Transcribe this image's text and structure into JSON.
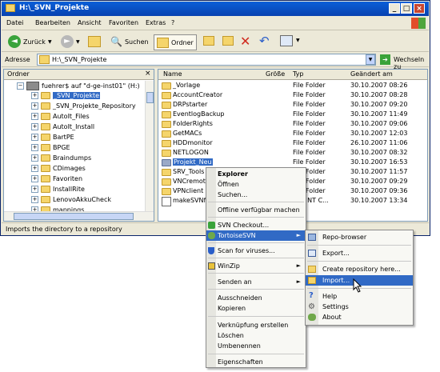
{
  "window": {
    "title": "H:\\_SVN_Projekte",
    "menu": [
      "Datei",
      "Bearbeiten",
      "Ansicht",
      "Favoriten",
      "Extras",
      "?"
    ],
    "toolbar": {
      "back": "Zurück",
      "search": "Suchen",
      "folders": "Ordner"
    },
    "address": {
      "label": "Adresse",
      "value": "H:\\_SVN_Projekte",
      "go": "Wechseln zu"
    },
    "status": "Imports the directory to a repository"
  },
  "tree": {
    "header": "Ordner",
    "root": "fuehrer$ auf \"d-ge-inst01\" (H:)",
    "items": [
      "_SVN_Projekte",
      "_SVN_Projekte_Repository",
      "AutoIt_Files",
      "AutoIt_Install",
      "BartPE",
      "BPGE",
      "Braindumps",
      "CDimages",
      "Favoriten",
      "InstallRite",
      "LenovoAkkuCheck",
      "mappings"
    ]
  },
  "files": {
    "columns": [
      "Name",
      "Größe",
      "Typ",
      "Geändert am"
    ],
    "rows": [
      {
        "name": "_Vorlage",
        "size": "",
        "type": "File Folder",
        "date": "30.10.2007 08:26"
      },
      {
        "name": "AccountCreator",
        "size": "",
        "type": "File Folder",
        "date": "30.10.2007 08:28"
      },
      {
        "name": "DRPstarter",
        "size": "",
        "type": "File Folder",
        "date": "30.10.2007 09:20"
      },
      {
        "name": "EventlogBackup",
        "size": "",
        "type": "File Folder",
        "date": "30.10.2007 11:49"
      },
      {
        "name": "FolderRights",
        "size": "",
        "type": "File Folder",
        "date": "30.10.2007 09:06"
      },
      {
        "name": "GetMACs",
        "size": "",
        "type": "File Folder",
        "date": "30.10.2007 12:03"
      },
      {
        "name": "HDDmonitor",
        "size": "",
        "type": "File Folder",
        "date": "26.10.2007 11:06"
      },
      {
        "name": "NETLOGON",
        "size": "",
        "type": "File Folder",
        "date": "30.10.2007 08:32"
      },
      {
        "name": "Projekt_Neu",
        "size": "",
        "type": "File Folder",
        "date": "30.10.2007 16:53"
      },
      {
        "name": "SRV_Tools",
        "size": "",
        "type": "File Folder",
        "date": "30.10.2007 11:57"
      },
      {
        "name": "VNCremote",
        "size": "",
        "type": "File Folder",
        "date": "30.10.2007 09:29"
      },
      {
        "name": "VPNclient",
        "size": "",
        "type": "File Folder",
        "date": "30.10.2007 09:36"
      },
      {
        "name": "makeSVNfolc",
        "size": "",
        "type": "ows NT C...",
        "date": "30.10.2007 13:34"
      }
    ]
  },
  "context_menu": {
    "items": [
      "Explorer",
      "Öffnen",
      "Suchen...",
      "Offline verfügbar machen",
      "SVN Checkout...",
      "TortoiseSVN",
      "Scan for viruses...",
      "WinZip",
      "Senden an",
      "Ausschneiden",
      "Kopieren",
      "Verknüpfung erstellen",
      "Löschen",
      "Umbenennen",
      "Eigenschaften"
    ]
  },
  "submenu": {
    "items": [
      "Repo-browser",
      "Export...",
      "Create repository here...",
      "Import...",
      "Help",
      "Settings",
      "About"
    ]
  },
  "colors": {
    "selection": "#316ac5",
    "title": "#0842b0"
  }
}
